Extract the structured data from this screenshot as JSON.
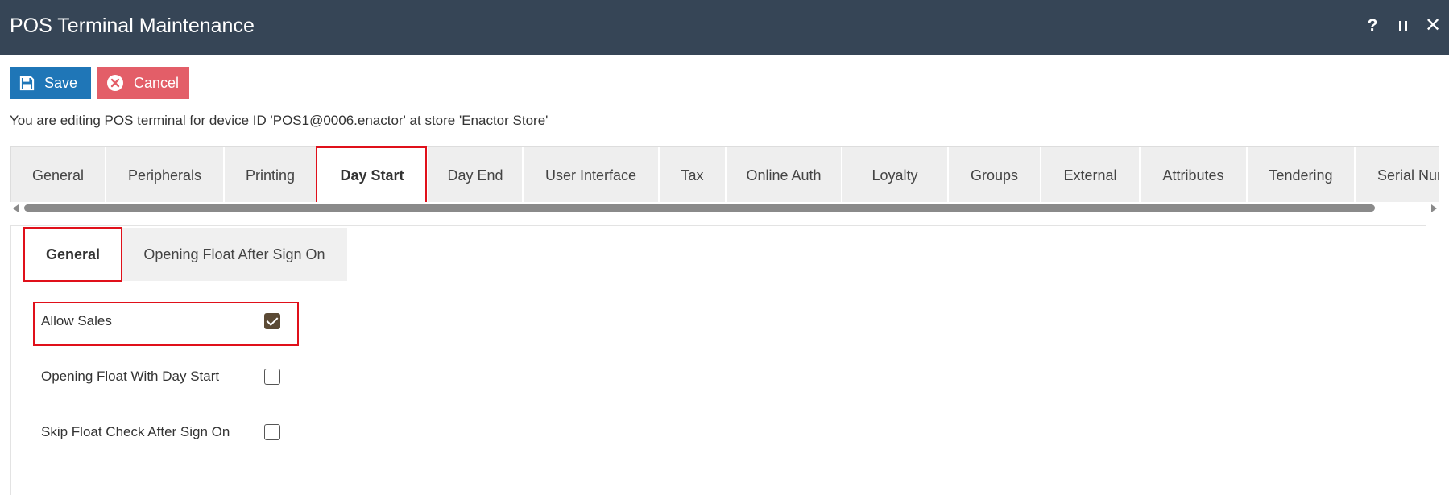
{
  "window": {
    "title": "POS Terminal Maintenance",
    "help_label": "?",
    "close_label": "✕"
  },
  "toolbar": {
    "save_label": "Save",
    "cancel_label": "Cancel"
  },
  "info_text": "You are editing POS terminal for device ID 'POS1@0006.enactor' at store 'Enactor Store'",
  "tabs": [
    {
      "label": "General"
    },
    {
      "label": "Peripherals"
    },
    {
      "label": "Printing"
    },
    {
      "label": "Day Start",
      "active": true
    },
    {
      "label": "Day End"
    },
    {
      "label": "User Interface"
    },
    {
      "label": "Tax"
    },
    {
      "label": "Online Auth"
    },
    {
      "label": "Loyalty"
    },
    {
      "label": "Groups"
    },
    {
      "label": "External"
    },
    {
      "label": "Attributes"
    },
    {
      "label": "Tendering"
    },
    {
      "label": "Serial Num"
    }
  ],
  "subtabs": [
    {
      "label": "General",
      "active": true
    },
    {
      "label": "Opening Float After Sign On"
    }
  ],
  "fields": [
    {
      "label": "Allow Sales",
      "checked": true
    },
    {
      "label": "Opening Float With Day Start",
      "checked": false
    },
    {
      "label": "Skip Float Check After Sign On",
      "checked": false
    }
  ],
  "colors": {
    "titlebar": "#364556",
    "save_button": "#1f76b7",
    "cancel_button": "#e35e68",
    "highlight": "#e0101a",
    "checkbox_checked": "#5b4a35"
  }
}
